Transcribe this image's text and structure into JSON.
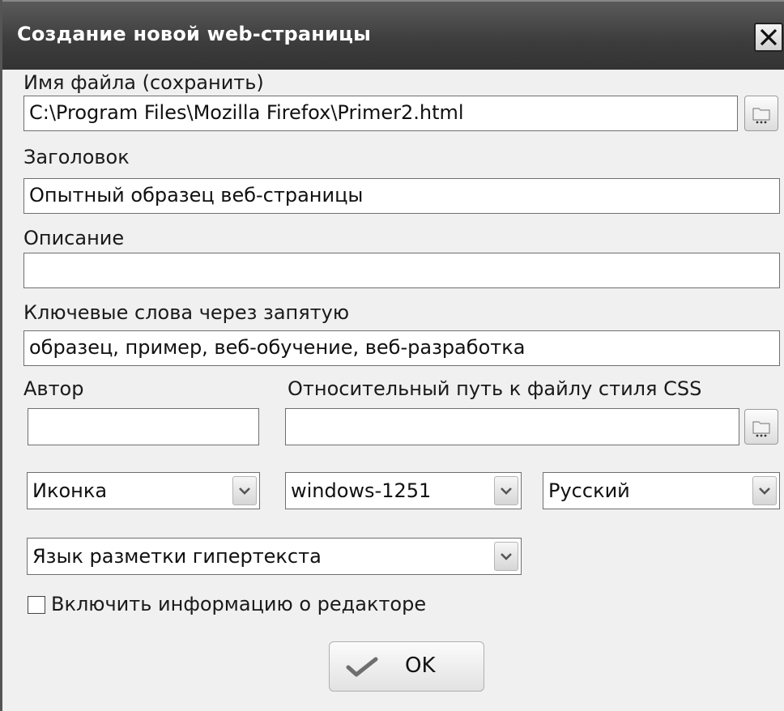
{
  "window": {
    "title": "Создание новой web-страницы"
  },
  "filename": {
    "label": "Имя файла (сохранить)",
    "value": "C:\\Program Files\\Mozilla Firefox\\Primer2.html"
  },
  "heading": {
    "label": "Заголовок",
    "value": "Опытный образец веб-страницы"
  },
  "description": {
    "label": "Описание",
    "value": ""
  },
  "keywords": {
    "label": "Ключевые слова через запятую",
    "value": "образец, пример, веб-обучение, веб-разработка"
  },
  "author": {
    "label": "Автор",
    "value": ""
  },
  "css_path": {
    "label": "Относительный путь к файлу стиля CSS",
    "value": ""
  },
  "selects": {
    "icon": "Иконка",
    "encoding": "windows-1251",
    "language": "Русский",
    "doctype": "Язык разметки гипертекста"
  },
  "editor_info": {
    "label": "Включить информацию о редакторе",
    "checked": false
  },
  "ok_button": {
    "label": "OK"
  }
}
